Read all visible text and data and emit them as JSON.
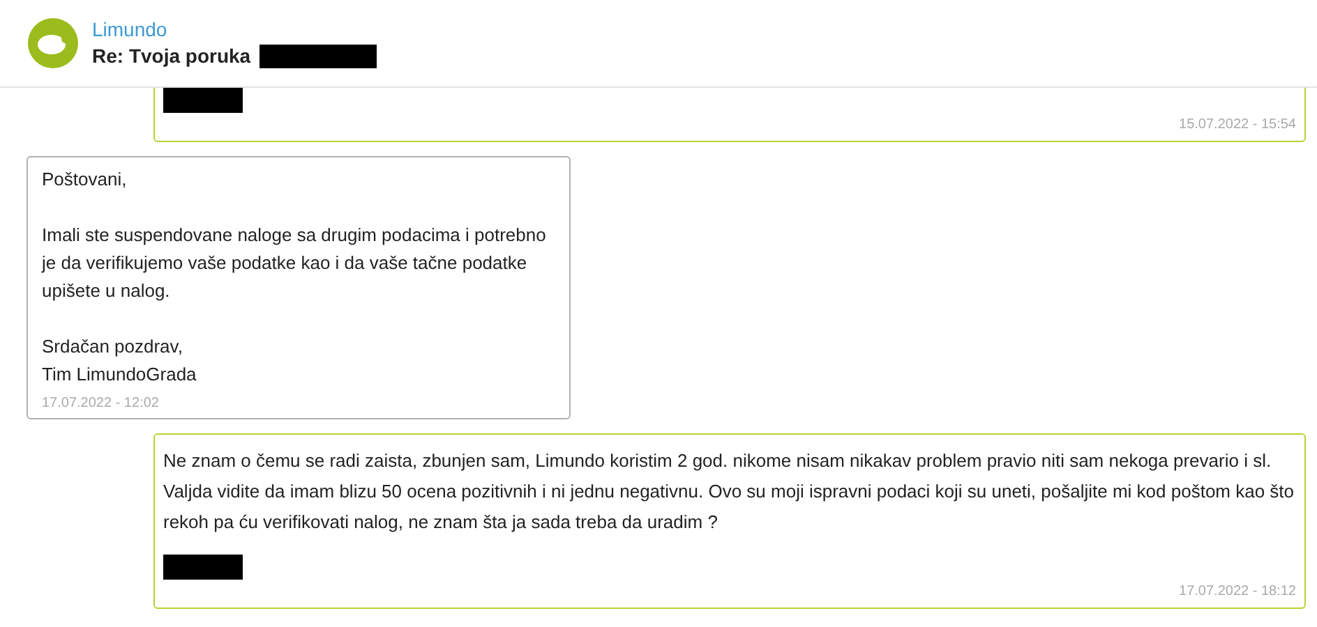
{
  "header": {
    "sender": "Limundo",
    "subject": "Re: Tvoja poruka",
    "subject_redacted": true
  },
  "messages": [
    {
      "kind": "outgoing",
      "redacted": true,
      "time": "15.07.2022 - 15:54"
    },
    {
      "kind": "incoming",
      "paragraphs": [
        "Poštovani,",
        "Imali ste suspendovane naloge sa drugim podacima i potrebno je da verifikujemo vaše podatke kao i da vaše tačne podatke upišete u nalog.",
        "Srdačan pozdrav,\nTim LimundoGrada"
      ],
      "redacted": false,
      "time": "17.07.2022 - 12:02"
    },
    {
      "kind": "outgoing",
      "paragraphs": [
        "Ne znam o čemu se radi zaista, zbunjen sam, Limundo koristim 2 god. nikome nisam nikakav problem pravio niti sam nekoga prevario i sl. Valjda vidite da imam blizu 50 ocena pozitivnih i ni jednu negativnu. Ovo su moji ispravni podaci koji su uneti, pošaljite mi kod poštom kao što rekoh pa ću verifikovati nalog, ne znam šta ja sada treba da uradim ?"
      ],
      "redacted": true,
      "time": "17.07.2022 - 18:12"
    }
  ]
}
